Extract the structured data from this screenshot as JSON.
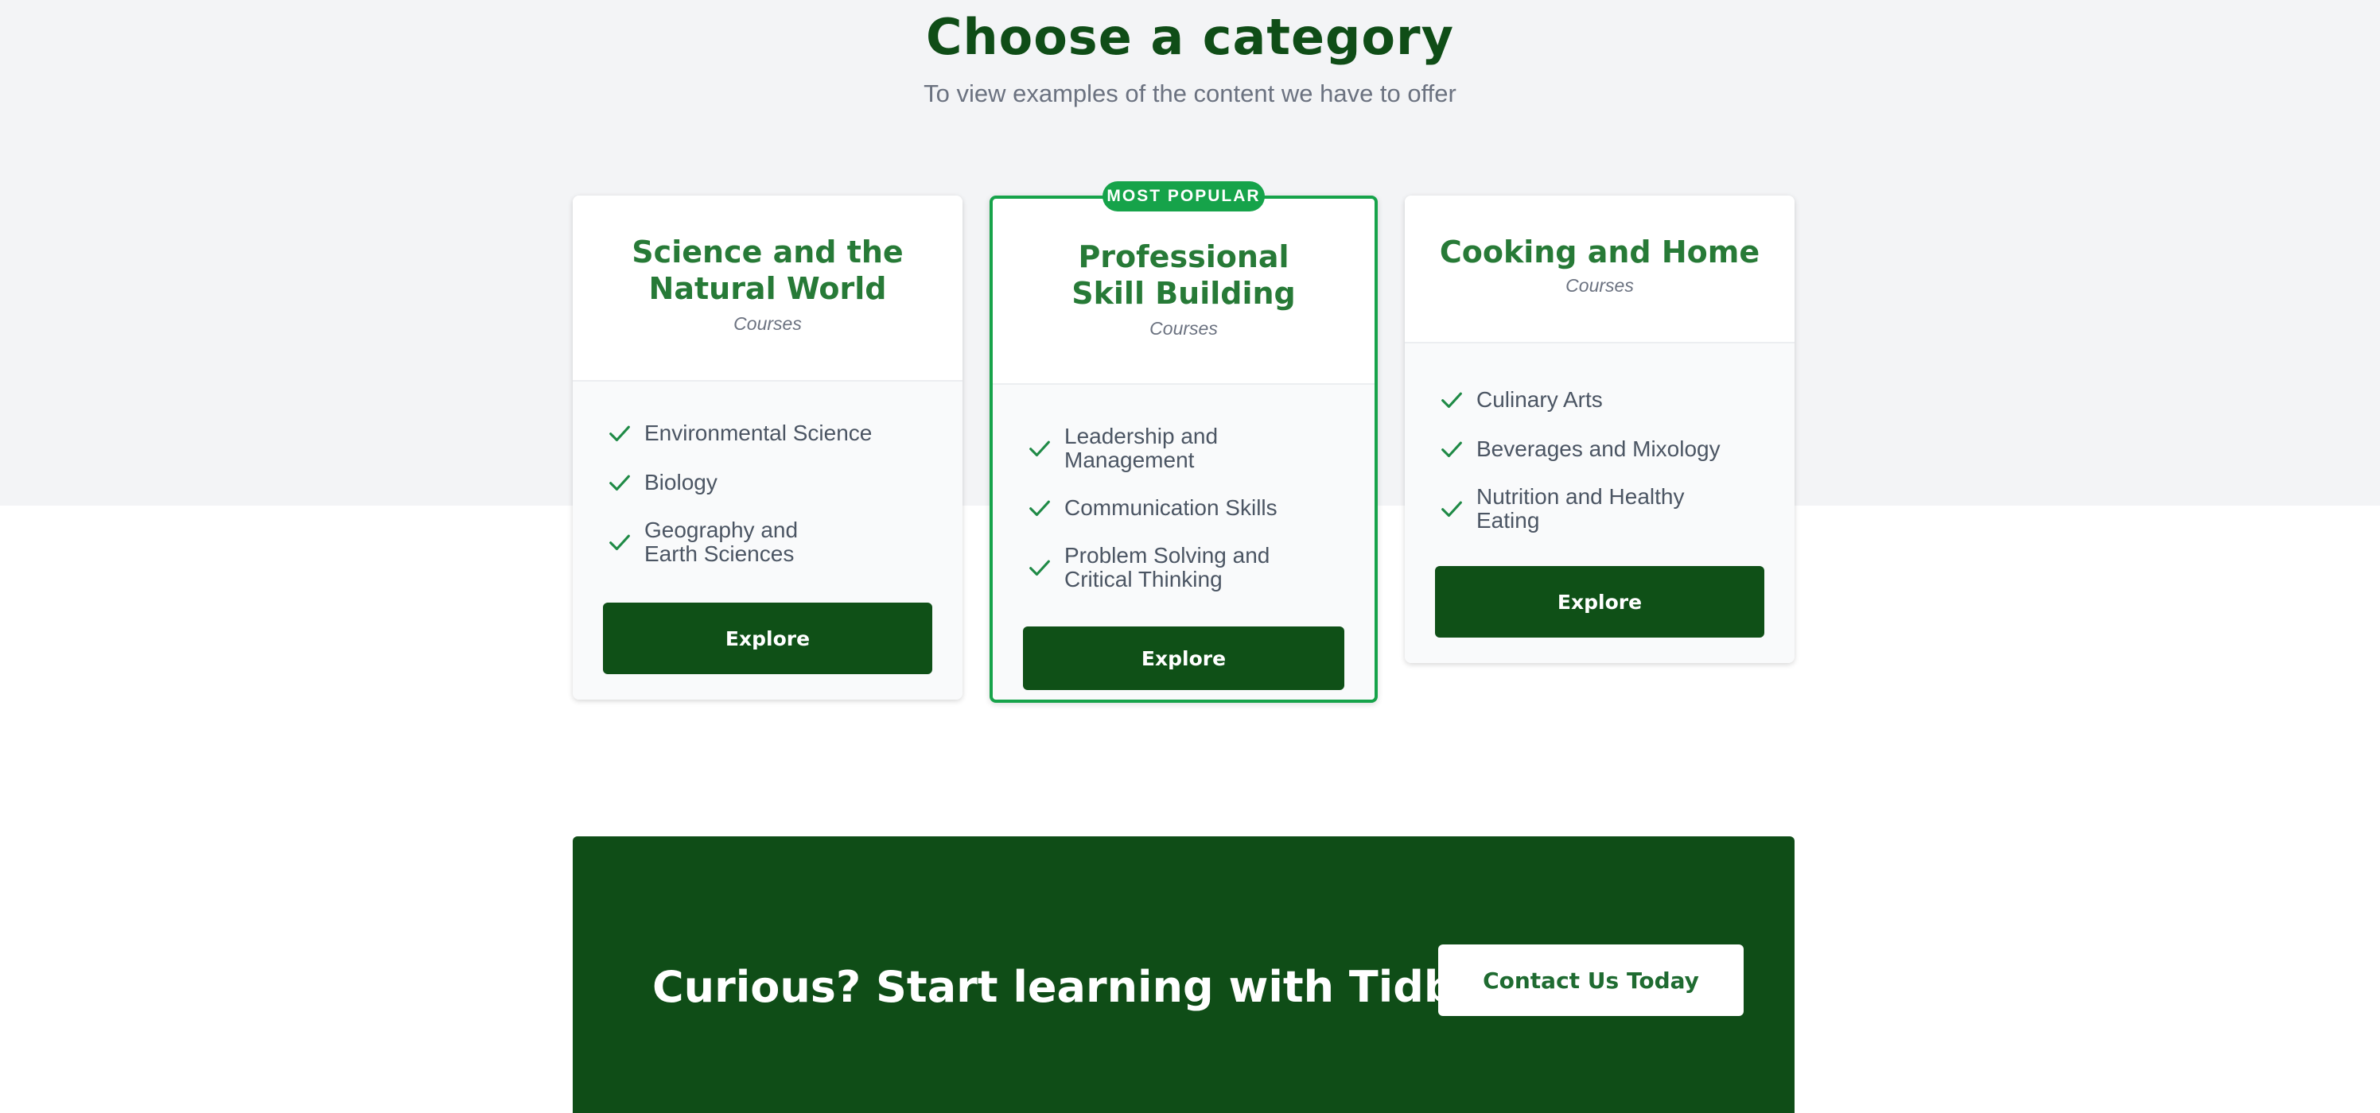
{
  "header": {
    "title": "Choose a category",
    "subtitle": "To view examples of the content we have to offer"
  },
  "colors": {
    "brand_dark_green": "#0f4d17",
    "accent_green": "#16a34a",
    "card_title_green": "#277a37",
    "text_gray": "#4b5563",
    "band_bg": "#f3f4f6"
  },
  "categories": [
    {
      "title": "Science and the Natural World",
      "subtitle": "Courses",
      "features": [
        {
          "label": "Environmental Science",
          "icon": "check-icon"
        },
        {
          "label": "Biology",
          "icon": "check-icon"
        },
        {
          "label": "Geography and Earth Sciences",
          "icon": "check-icon"
        }
      ],
      "button": "Explore"
    },
    {
      "badge": "MOST POPULAR",
      "title": "Professional Skill Building",
      "subtitle": "Courses",
      "features": [
        {
          "label": "Leadership and Management",
          "icon": "check-icon"
        },
        {
          "label": "Communication Skills",
          "icon": "check-icon"
        },
        {
          "label": "Problem Solving and Critical Thinking",
          "icon": "check-icon"
        }
      ],
      "button": "Explore"
    },
    {
      "title": "Cooking and Home",
      "subtitle": "Courses",
      "features": [
        {
          "label": "Culinary Arts",
          "icon": "check-icon"
        },
        {
          "label": "Beverages and Mixology",
          "icon": "check-icon"
        },
        {
          "label": "Nutrition and Healthy Eating",
          "icon": "check-icon"
        }
      ],
      "button": "Explore"
    }
  ],
  "cta": {
    "text": "Curious? Start learning with Tidbitz",
    "button": "Contact Us Today"
  }
}
